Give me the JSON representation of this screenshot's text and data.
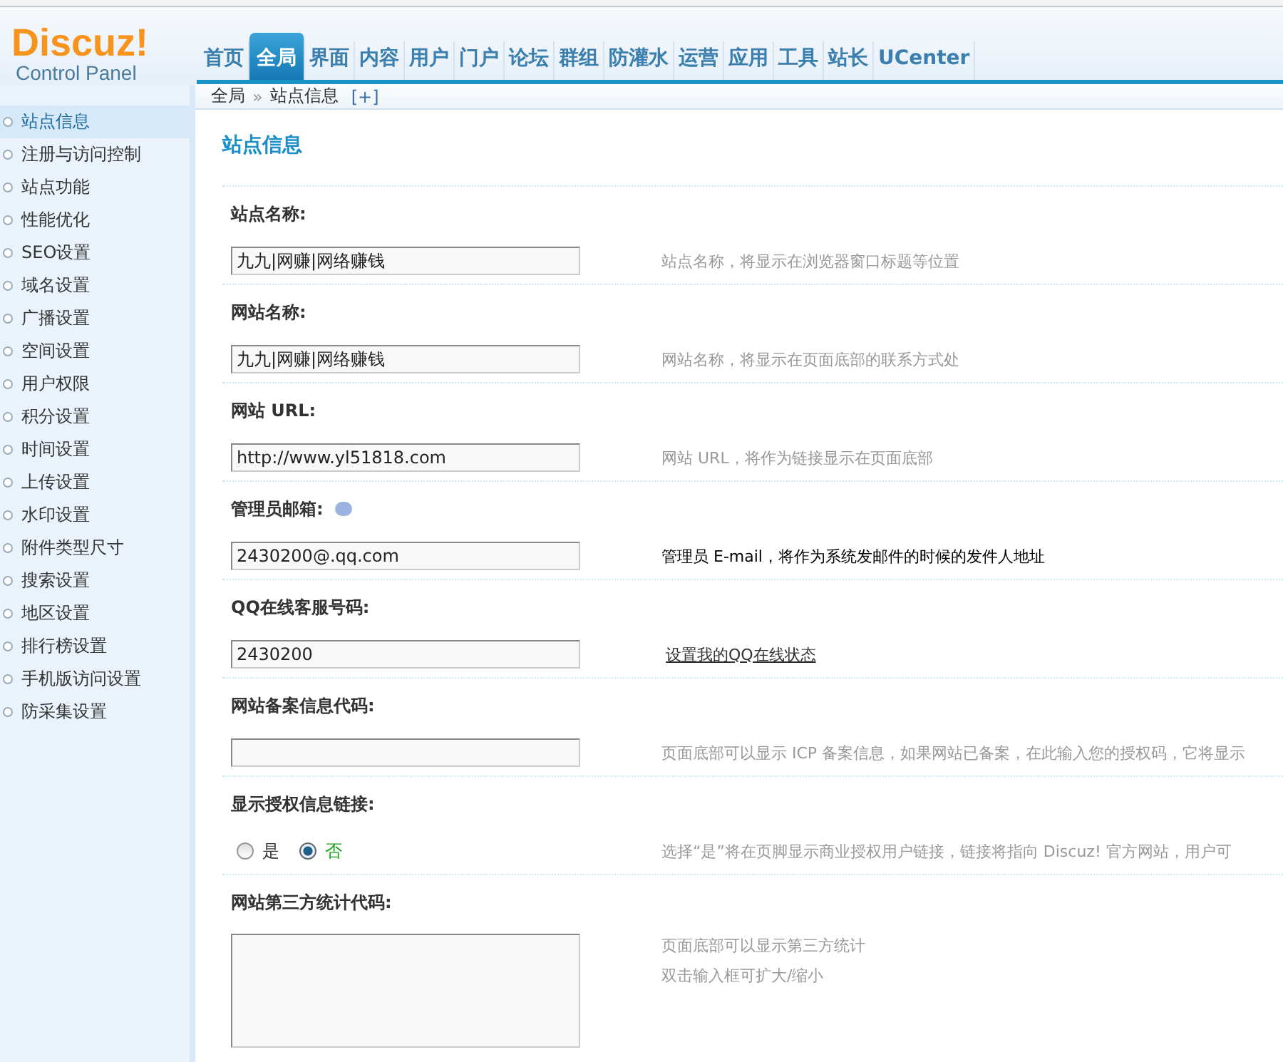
{
  "logo": {
    "title": "Discuz!",
    "subtitle": "Control Panel"
  },
  "nav": [
    {
      "label": "首页",
      "selected": false
    },
    {
      "label": "全局",
      "selected": true
    },
    {
      "label": "界面",
      "selected": false
    },
    {
      "label": "内容",
      "selected": false
    },
    {
      "label": "用户",
      "selected": false
    },
    {
      "label": "门户",
      "selected": false
    },
    {
      "label": "论坛",
      "selected": false
    },
    {
      "label": "群组",
      "selected": false
    },
    {
      "label": "防灌水",
      "selected": false
    },
    {
      "label": "运营",
      "selected": false
    },
    {
      "label": "应用",
      "selected": false
    },
    {
      "label": "工具",
      "selected": false
    },
    {
      "label": "站长",
      "selected": false
    },
    {
      "label": "UCenter",
      "selected": false
    }
  ],
  "breadcrumb": {
    "items": [
      "全局",
      "站点信息"
    ],
    "separator": "»",
    "add": "[+]"
  },
  "sidebar": {
    "items": [
      {
        "label": "站点信息",
        "selected": true
      },
      {
        "label": "注册与访问控制",
        "selected": false
      },
      {
        "label": "站点功能",
        "selected": false
      },
      {
        "label": "性能优化",
        "selected": false
      },
      {
        "label": "SEO设置",
        "selected": false
      },
      {
        "label": "域名设置",
        "selected": false
      },
      {
        "label": "广播设置",
        "selected": false
      },
      {
        "label": "空间设置",
        "selected": false
      },
      {
        "label": "用户权限",
        "selected": false
      },
      {
        "label": "积分设置",
        "selected": false
      },
      {
        "label": "时间设置",
        "selected": false
      },
      {
        "label": "上传设置",
        "selected": false
      },
      {
        "label": "水印设置",
        "selected": false
      },
      {
        "label": "附件类型尺寸",
        "selected": false
      },
      {
        "label": "搜索设置",
        "selected": false
      },
      {
        "label": "地区设置",
        "selected": false
      },
      {
        "label": "排行榜设置",
        "selected": false
      },
      {
        "label": "手机版访问设置",
        "selected": false
      },
      {
        "label": "防采集设置",
        "selected": false
      }
    ]
  },
  "page_title": "站点信息",
  "fields": [
    {
      "kind": "text",
      "label": "站点名称:",
      "value": "九九|网赚|网络赚钱",
      "tip": {
        "kind": "note",
        "lines": [
          "站点名称，将显示在浏览器窗口标题等位置"
        ]
      }
    },
    {
      "kind": "text",
      "label": "网站名称:",
      "value": "九九|网赚|网络赚钱",
      "tip": {
        "kind": "note",
        "lines": [
          "网站名称，将显示在页面底部的联系方式处"
        ]
      }
    },
    {
      "kind": "text",
      "label": "网站 URL:",
      "value": "http://www.yl51818.com",
      "tip": {
        "kind": "note",
        "lines": [
          "网站 URL，将作为链接显示在页面底部"
        ]
      }
    },
    {
      "kind": "text",
      "label": "管理员邮箱:",
      "value": "2430200@.qq.com",
      "help": true,
      "tip": {
        "kind": "strong",
        "lines": [
          "管理员 E-mail，将作为系统发邮件的时候的发件人地址"
        ]
      }
    },
    {
      "kind": "text",
      "label": "QQ在线客服号码:",
      "value": "2430200",
      "tip": {
        "kind": "link",
        "lines": [
          "设置我的QQ在线状态"
        ]
      }
    },
    {
      "kind": "text",
      "label": "网站备案信息代码:",
      "tip": {
        "kind": "note",
        "lines": [
          "页面底部可以显示 ICP 备案信息，如果网站已备案，在此输入您的授权码，它将显示"
        ]
      }
    },
    {
      "kind": "radio",
      "label": "显示授权信息链接:",
      "options": [
        {
          "label": "是",
          "selected": false
        },
        {
          "label": "否",
          "selected": true
        }
      ],
      "tip": {
        "kind": "note",
        "lines": [
          "选择“是”将在页脚显示商业授权用户链接，链接将指向 Discuz! 官方网站，用户可"
        ]
      }
    },
    {
      "kind": "textarea",
      "label": "网站第三方统计代码:",
      "tip": {
        "kind": "note",
        "lines": [
          "页面底部可以显示第三方统计",
          "双击输入框可扩大/缩小"
        ]
      }
    }
  ]
}
